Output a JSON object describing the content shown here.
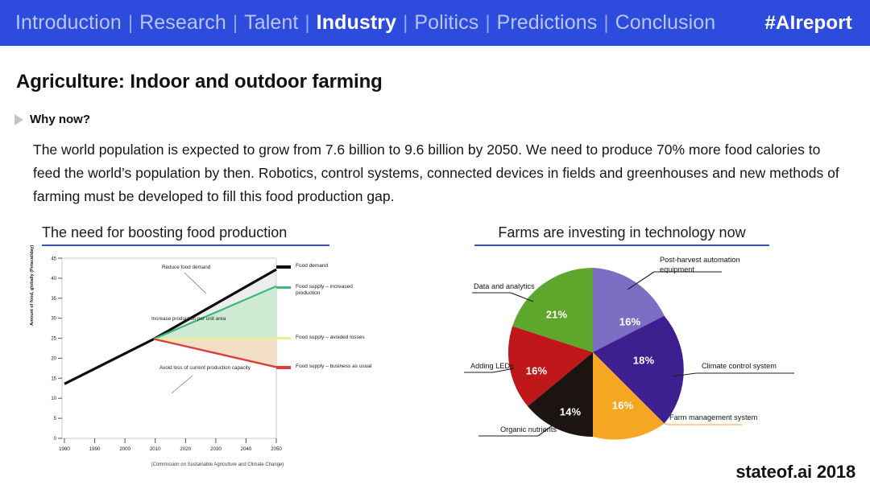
{
  "navbar": {
    "items": [
      {
        "label": "Introduction",
        "active": false
      },
      {
        "label": "Research",
        "active": false
      },
      {
        "label": "Talent",
        "active": false
      },
      {
        "label": "Industry",
        "active": true
      },
      {
        "label": "Politics",
        "active": false
      },
      {
        "label": "Predictions",
        "active": false
      },
      {
        "label": "Conclusion",
        "active": false
      }
    ],
    "separator": "|",
    "hashtag": "#AIreport",
    "background_color": "#2d4bdc",
    "active_color": "#ffffff",
    "inactive_color": "#b9c6f4"
  },
  "slide": {
    "title": "Agriculture: Indoor and outdoor farming",
    "bullet_label": "Why now?",
    "body": "The world population is expected to grow from 7.6 billion to 9.6 billion by 2050. We need to produce 70% more food calories to feed the world’s population by then. Robotics, control systems, connected devices in fields and greenhouses and new methods of farming must be developed to fill this food production gap.",
    "footer_brand": "stateof.ai 2018",
    "accent_color": "#3a51b5"
  },
  "panels": {
    "left_heading": "The need for boosting food production",
    "right_heading": "Farms are investing in technology now"
  },
  "chart_data": [
    {
      "type": "line",
      "title": "The need for boosting food production",
      "xlabel": "",
      "ylabel": "Amount of food, globally (Petacal/day)",
      "caption": "(Commission on Sustainable Agriculture and Climate Change)",
      "xlim": [
        1980,
        2050
      ],
      "ylim": [
        0,
        45
      ],
      "xticks": [
        1980,
        1990,
        2000,
        2010,
        2020,
        2030,
        2040,
        2050
      ],
      "yticks": [
        0,
        5,
        10,
        15,
        20,
        25,
        30,
        35,
        40,
        45
      ],
      "grid": false,
      "legend_position": "right",
      "annotations": [
        "Reduce food demand",
        "Increase production per unit area",
        "Avoid loss of current production capacity"
      ],
      "series": [
        {
          "name": "Food demand",
          "color": "#0d0d0d",
          "x": [
            1980,
            2010,
            2050
          ],
          "values": [
            13.6,
            24.8,
            42.2
          ]
        },
        {
          "name": "Food supply – increased production",
          "color": "#3cb878",
          "x": [
            1980,
            2010,
            2050
          ],
          "values": [
            13.6,
            24.8,
            38.0
          ]
        },
        {
          "name": "Food supply – avoided losses",
          "color": "#e8ef8a",
          "x": [
            1980,
            2010,
            2050
          ],
          "values": [
            13.6,
            24.8,
            24.8
          ]
        },
        {
          "name": "Food supply – business as usual",
          "color": "#d8413a",
          "x": [
            1980,
            2010,
            2050
          ],
          "values": [
            13.6,
            24.8,
            17.8
          ]
        }
      ]
    },
    {
      "type": "pie",
      "title": "Farms are investing in technology now",
      "start_angle_deg": 0,
      "direction": "clockwise",
      "slices": [
        {
          "label": "Post-harvest automation equipment",
          "value": 16,
          "value_label": "16%",
          "color": "#7b6fc4"
        },
        {
          "label": "Climate control system",
          "value": 18,
          "value_label": "18%",
          "color": "#3d1f8f"
        },
        {
          "label": "Farm management system",
          "value": 16,
          "value_label": "16%",
          "color": "#f5a623"
        },
        {
          "label": "Organic nutrients",
          "value": 14,
          "value_label": "14%",
          "color": "#1b1410"
        },
        {
          "label": "Adding LEDs",
          "value": 16,
          "value_label": "16%",
          "color": "#c0171a"
        },
        {
          "label": "Data and analytics",
          "value": 21,
          "value_label": "21%",
          "color": "#5fa72c"
        }
      ]
    }
  ]
}
